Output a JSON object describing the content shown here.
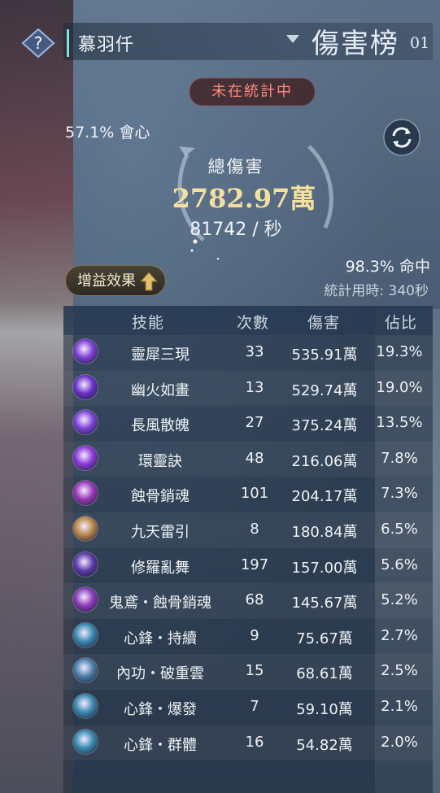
{
  "header": {
    "help_glyph": "?",
    "player_name": "慕羽仟",
    "board_title": "傷害榜",
    "board_number": "01"
  },
  "status": "未在統計中",
  "summary": {
    "crit": "57.1% 會心",
    "total_label": "總傷害",
    "total_value": "2782.97萬",
    "dps": "81742 / 秒",
    "hit": "98.3% 命中",
    "duration": "統計用時: 340秒"
  },
  "buff_button": "增益效果",
  "table": {
    "headers": [
      "技能",
      "次數",
      "傷害",
      "佔比"
    ],
    "rows": [
      {
        "skill": "靈犀三現",
        "count": "33",
        "damage": "535.91萬",
        "share": "19.3%",
        "icon_color": "#7a3fd0"
      },
      {
        "skill": "幽火如畫",
        "count": "13",
        "damage": "529.74萬",
        "share": "19.0%",
        "icon_color": "#6a32c8"
      },
      {
        "skill": "長風散魄",
        "count": "27",
        "damage": "375.24萬",
        "share": "13.5%",
        "icon_color": "#7a44d4"
      },
      {
        "skill": "環靈訣",
        "count": "48",
        "damage": "216.06萬",
        "share": "7.8%",
        "icon_color": "#8a3ad8"
      },
      {
        "skill": "蝕骨銷魂",
        "count": "101",
        "damage": "204.17萬",
        "share": "7.3%",
        "icon_color": "#9a38b8"
      },
      {
        "skill": "九天雷引",
        "count": "8",
        "damage": "180.84萬",
        "share": "6.5%",
        "icon_color": "#b8874a"
      },
      {
        "skill": "修羅亂舞",
        "count": "197",
        "damage": "157.00萬",
        "share": "5.6%",
        "icon_color": "#5b3aa8"
      },
      {
        "skill": "鬼鳶・蝕骨銷魂",
        "count": "68",
        "damage": "145.67萬",
        "share": "5.2%",
        "icon_color": "#8a3ab8"
      },
      {
        "skill": "心鋒・持續",
        "count": "9",
        "damage": "75.67萬",
        "share": "2.7%",
        "icon_color": "#3a8ab0"
      },
      {
        "skill": "內功・破重雲",
        "count": "15",
        "damage": "68.61萬",
        "share": "2.5%",
        "icon_color": "#4a7ea8"
      },
      {
        "skill": "心鋒・爆發",
        "count": "7",
        "damage": "59.10萬",
        "share": "2.1%",
        "icon_color": "#3a8ab0"
      },
      {
        "skill": "心鋒・群體",
        "count": "16",
        "damage": "54.82萬",
        "share": "2.0%",
        "icon_color": "#3a8ab0"
      }
    ]
  },
  "icons": {
    "help": "question-diamond-icon",
    "dropdown": "triangle-down-icon",
    "refresh": "refresh-icon",
    "buff": "up-arrow-emblem-icon"
  },
  "colors": {
    "accent_teal": "#7fe3d8",
    "status_red": "#ff8a7a",
    "total_gold": "#f4dfa0"
  }
}
